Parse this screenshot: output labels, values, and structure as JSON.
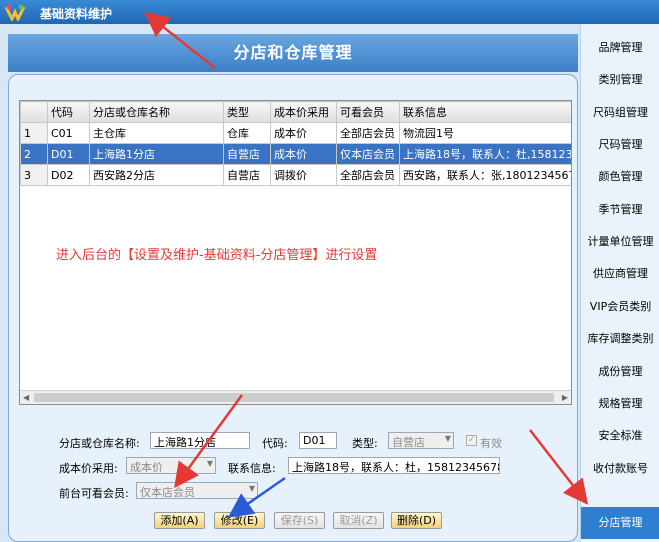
{
  "window": {
    "title": "基础资料维护"
  },
  "banner": {
    "title": "分店和仓库管理"
  },
  "grid": {
    "headers": [
      "",
      "代码",
      "分店或仓库名称",
      "类型",
      "成本价采用",
      "可看会员",
      "联系信息"
    ],
    "rows": [
      {
        "num": "1",
        "code": "C01",
        "name": "主仓库",
        "type": "仓库",
        "cost": "成本价",
        "member": "全部店会员",
        "contact": "物流园1号"
      },
      {
        "num": "2",
        "code": "D01",
        "name": "上海路1分店",
        "type": "自营店",
        "cost": "成本价",
        "member": "仅本店会员",
        "contact": "上海路18号，联系人：杜,1581234"
      },
      {
        "num": "3",
        "code": "D02",
        "name": "西安路2分店",
        "type": "自营店",
        "cost": "调拨价",
        "member": "全部店会员",
        "contact": "西安路，联系人：张,18012345678"
      }
    ],
    "selected_row": 2
  },
  "notice": "进入后台的【设置及维护-基础资料-分店管理】进行设置",
  "form": {
    "name_label": "分店或仓库名称:",
    "name_value": "上海路1分店",
    "code_label": "代码:",
    "code_value": "D01",
    "type_label": "类型:",
    "type_value": "自营店",
    "valid_label": "有效",
    "cost_label": "成本价采用:",
    "cost_value": "成本价",
    "contact_label": "联系信息:",
    "contact_value": "上海路18号，联系人：杜，15812345678",
    "member_label": "前台可看会员:",
    "member_value": "仅本店会员"
  },
  "buttons": {
    "add": "添加(A)",
    "edit": "修改(E)",
    "save": "保存(S)",
    "cancel": "取消(Z)",
    "delete": "删除(D)"
  },
  "sidebar": {
    "items": [
      "品牌管理",
      "类别管理",
      "尺码组管理",
      "尺码管理",
      "颜色管理",
      "季节管理",
      "计量单位管理",
      "供应商管理",
      "VIP会员类别",
      "库存调整类别",
      "成份管理",
      "规格管理",
      "安全标准",
      "收付款账号",
      "分店管理"
    ],
    "selected": "分店管理"
  },
  "colors": {
    "accent": "#2f7fd0",
    "selected_row": "#3a72c4",
    "notice": "#e53935",
    "arrow_red": "#e53935",
    "arrow_blue": "#2a5bd7"
  }
}
